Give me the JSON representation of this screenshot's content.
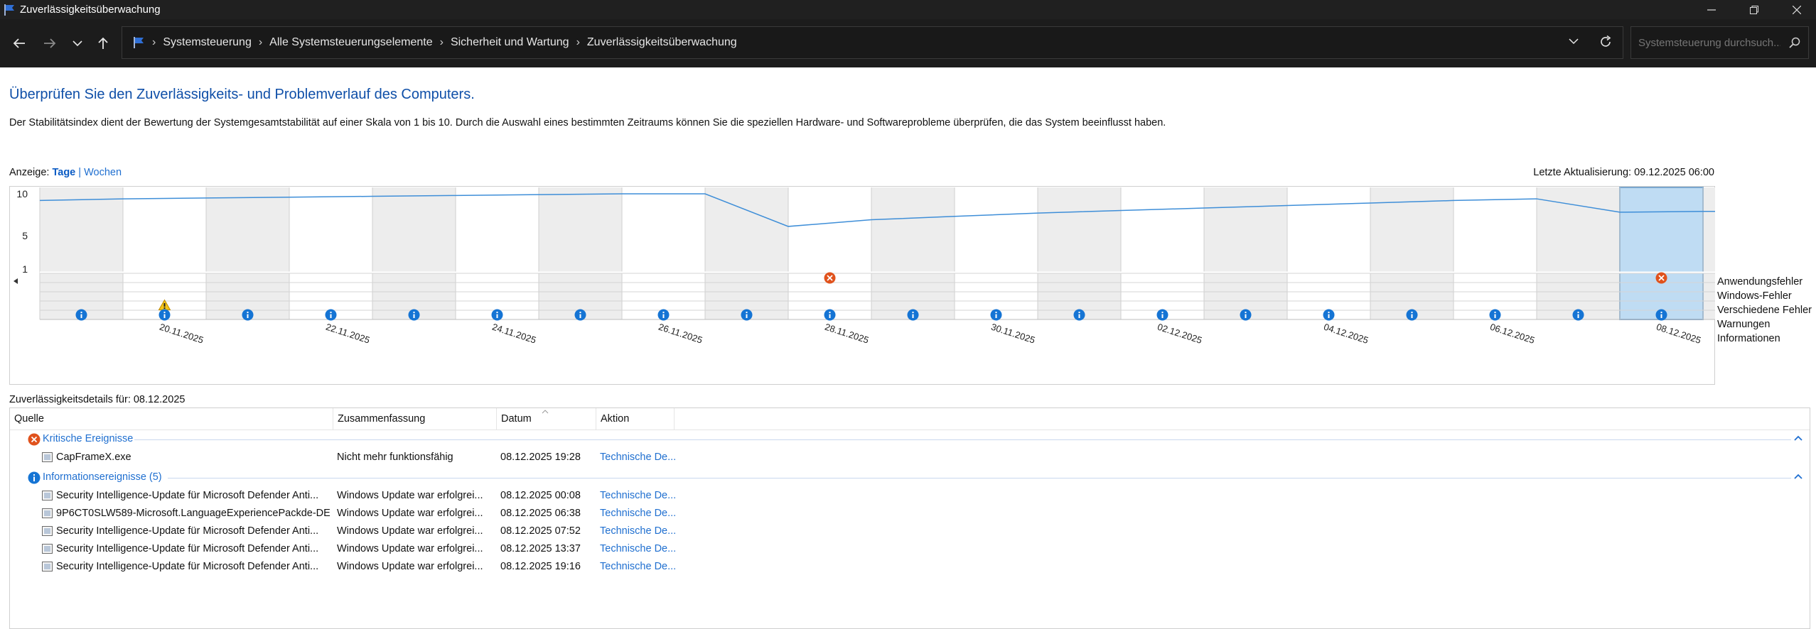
{
  "window": {
    "title": "Zuverlässigkeitsüberwachung"
  },
  "address": {
    "breadcrumbs": [
      "Systemsteuerung",
      "Alle Systemsteuerungselemente",
      "Sicherheit und Wartung",
      "Zuverlässigkeitsüberwachung"
    ],
    "search_placeholder": "Systemsteuerung durchsuch..."
  },
  "page": {
    "heading": "Überprüfen Sie den Zuverlässigkeits- und Problemverlauf des Computers.",
    "description": "Der Stabilitätsindex dient der Bewertung der Systemgesamtstabilität auf einer Skala von 1 bis 10. Durch die Auswahl eines bestimmten Zeitraums können Sie die speziellen Hardware- und Softwareprobleme überprüfen, die das System beeinflusst haben.",
    "view_label": "Anzeige:",
    "view_days": "Tage",
    "view_sep": "|",
    "view_weeks": "Wochen",
    "last_update": "Letzte Aktualisierung: 09.12.2025 06:00"
  },
  "chart_data": {
    "type": "line",
    "title": "",
    "y_ticks": [
      "10",
      "5",
      "1"
    ],
    "ylim": [
      1,
      10
    ],
    "columns": [
      "19.11.2025",
      "20.11.2025",
      "21.11.2025",
      "22.11.2025",
      "23.11.2025",
      "24.11.2025",
      "25.11.2025",
      "26.11.2025",
      "27.11.2025",
      "28.11.2025",
      "29.11.2025",
      "30.11.2025",
      "01.12.2025",
      "02.12.2025",
      "03.12.2025",
      "04.12.2025",
      "05.12.2025",
      "06.12.2025",
      "07.12.2025",
      "08.12.2025",
      "09.12.2025"
    ],
    "x_tick_labels": [
      "20.11.2025",
      "22.11.2025",
      "24.11.2025",
      "26.11.2025",
      "28.11.2025",
      "30.11.2025",
      "02.12.2025",
      "04.12.2025",
      "06.12.2025",
      "08.12.2025"
    ],
    "stability_index": [
      9.2,
      9.4,
      9.5,
      9.6,
      9.7,
      9.8,
      9.9,
      10.0,
      10.0,
      6.1,
      6.9,
      7.3,
      7.7,
      8.0,
      8.3,
      8.6,
      8.9,
      9.2,
      9.4,
      7.8,
      7.9
    ],
    "selected_column": "08.12.2025",
    "row_labels": [
      "Anwendungsfehler",
      "Windows-Fehler",
      "Verschiedene Fehler",
      "Warnungen",
      "Informationen"
    ],
    "events": {
      "Anwendungsfehler": [
        "28.11.2025",
        "08.12.2025"
      ],
      "Windows-Fehler": [],
      "Verschiedene Fehler": [],
      "Warnungen": [
        "20.11.2025"
      ],
      "Informationen": [
        "19.11.2025",
        "20.11.2025",
        "21.11.2025",
        "22.11.2025",
        "23.11.2025",
        "24.11.2025",
        "25.11.2025",
        "26.11.2025",
        "27.11.2025",
        "28.11.2025",
        "29.11.2025",
        "30.11.2025",
        "01.12.2025",
        "02.12.2025",
        "03.12.2025",
        "04.12.2025",
        "05.12.2025",
        "06.12.2025",
        "07.12.2025",
        "08.12.2025",
        "09.12.2025"
      ]
    }
  },
  "details": {
    "title": "Zuverlässigkeitsdetails für: 08.12.2025",
    "columns": [
      "Quelle",
      "Zusammenfassung",
      "Datum",
      "Aktion"
    ],
    "critical_group": "Kritische Ereignisse",
    "critical_rows": [
      {
        "source": "CapFrameX.exe",
        "summary": "Nicht mehr funktionsfähig",
        "date": "08.12.2025 19:28",
        "action": "Technische De..."
      }
    ],
    "info_group": "Informationsereignisse (5)",
    "info_rows": [
      {
        "source": "Security Intelligence-Update für Microsoft Defender Anti...",
        "summary": "Windows Update war erfolgrei...",
        "date": "08.12.2025 00:08",
        "action": "Technische De..."
      },
      {
        "source": "9P6CT0SLW589-Microsoft.LanguageExperiencePackde-DE",
        "summary": "Windows Update war erfolgrei...",
        "date": "08.12.2025 06:38",
        "action": "Technische De..."
      },
      {
        "source": "Security Intelligence-Update für Microsoft Defender Anti...",
        "summary": "Windows Update war erfolgrei...",
        "date": "08.12.2025 07:52",
        "action": "Technische De..."
      },
      {
        "source": "Security Intelligence-Update für Microsoft Defender Anti...",
        "summary": "Windows Update war erfolgrei...",
        "date": "08.12.2025 13:37",
        "action": "Technische De..."
      },
      {
        "source": "Security Intelligence-Update für Microsoft Defender Anti...",
        "summary": "Windows Update war erfolgrei...",
        "date": "08.12.2025 19:16",
        "action": "Technische De..."
      }
    ]
  }
}
